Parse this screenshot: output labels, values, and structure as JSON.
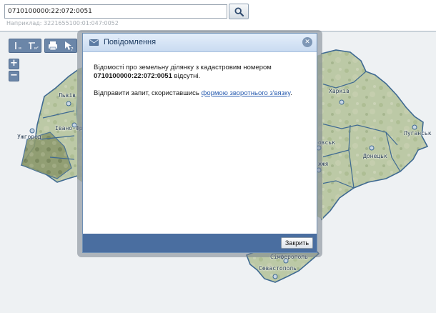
{
  "search": {
    "value": "0710100000:22:072:0051",
    "hint": "Наприклад: 3221655100:01:047:0052"
  },
  "toolbar": {
    "zoom_in": "+",
    "zoom_out": "−"
  },
  "map": {
    "cities": {
      "lviv": "Львів",
      "ivano_frankivsk": "Івано-Фр",
      "uzhhorod": "Ужгород",
      "kharkiv": "Харків",
      "dnipro": "ровськ",
      "zaporizhzhia": "жжя",
      "donetsk": "Донецьк",
      "luhansk": "Луганськ",
      "simferopol": "Сімферополь",
      "sevastopol": "Севастополь"
    },
    "colors": {
      "border": "#3f6a92",
      "terrain": "#b9c79f"
    }
  },
  "dialog": {
    "title": "Повідомлення",
    "line1_prefix": "Відомості про земельну ділянку з кадастровим номером",
    "cadastral_number": "0710100000:22:072:0051",
    "line1_suffix": "відсутні.",
    "line2_prefix": "Відправити запит, скориставшись",
    "link_text": "формою зворотнього з'вязку",
    "line2_suffix": ".",
    "close_label": "Закрить"
  }
}
